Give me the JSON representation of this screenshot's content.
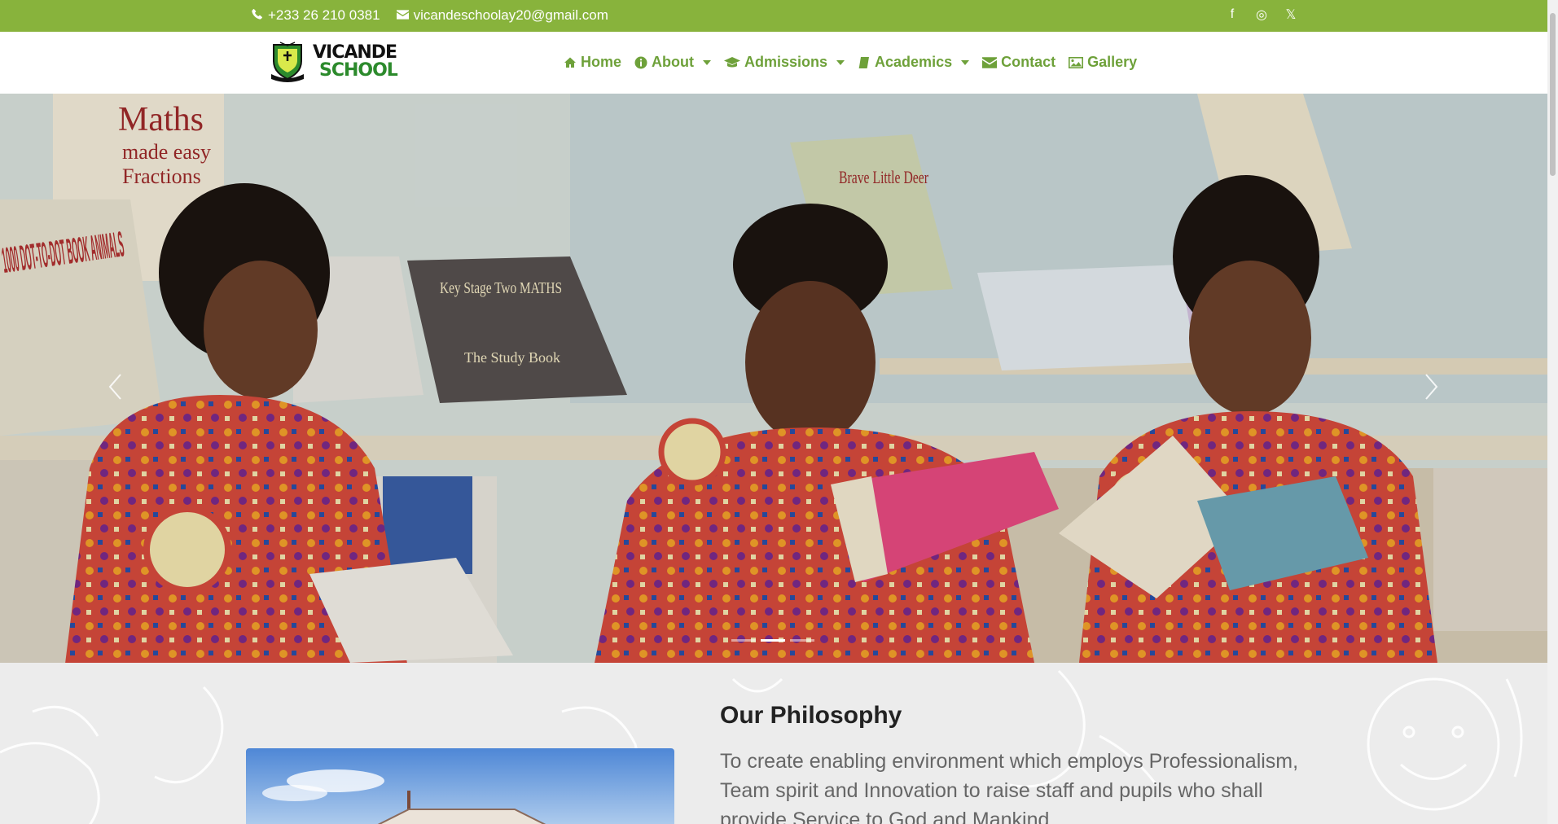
{
  "topbar": {
    "phone": "+233 26 210 0381",
    "email": "vicandeschoolay20@gmail.com",
    "social": [
      {
        "name": "facebook-icon",
        "glyph": "f"
      },
      {
        "name": "instagram-icon",
        "glyph": "◎"
      },
      {
        "name": "x-twitter-icon",
        "glyph": "𝕏"
      }
    ]
  },
  "brand": {
    "line1": "VICANDE",
    "line2": "SCHOOL",
    "colors": {
      "green": "#88b33c",
      "dark_green": "#2c8a2c",
      "nav": "#6ea13a"
    }
  },
  "nav": {
    "home": "Home",
    "about": "About",
    "admissions": "Admissions",
    "academics": "Academics",
    "contact": "Contact",
    "gallery": "Gallery"
  },
  "hero": {
    "slides_count": 3,
    "active_slide": 2,
    "book_titles": {
      "maths": "Maths",
      "made_easy": "made easy",
      "fractions": "Fractions",
      "dot": "1000 DOT-TO-DOT BOOK ANIMALS",
      "key_stage": "Key Stage Two MATHS",
      "study_book": "The Study Book",
      "deer": "Brave Little Deer"
    }
  },
  "philosophy": {
    "title": "Our Philosophy",
    "text": "To create enabling environment which employs Professionalism, Team spirit and Innovation to raise staff and pupils who shall provide Service to God and Mankind"
  }
}
